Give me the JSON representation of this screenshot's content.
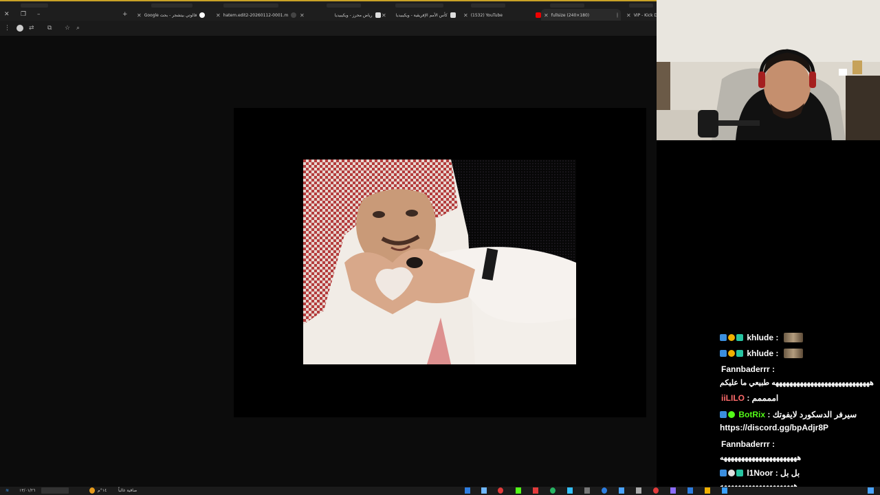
{
  "browser": {
    "tabs": [
      {
        "label": "Google ﻗﺎﻟﻮﺗﻲ ﺑﻴﺘﺸﺠﺮ - ﺑﺤﺚ",
        "favicon_color": "#ffffff"
      },
      {
        "label": "hatem.edit2-20260112-0001.m",
        "favicon_color": "#ff4d4d"
      },
      {
        "label": "ﺭﻳﺎﺽ ﻣﺤﺮﺯ - ﻭﻳﻜﻴﺒﻴﺪﻳﺎ",
        "favicon_color": "#dddddd"
      },
      {
        "label": "ﻛﺄﺱ ﺍﻷﻣﻢ ﺍﻹﻓﺮﻳﻘﻴﺔ - ﻭﻳﻜﻴﺒﻴﺪﻳﺎ",
        "favicon_color": "#dddddd"
      },
      {
        "label": "(1532) YouTube",
        "favicon_color": "#ff0000"
      },
      {
        "label": "fullsize (240×180)",
        "favicon_color": "#555555"
      },
      {
        "label": "VIP - Kick Do",
        "favicon_color": "#53fc18"
      }
    ]
  },
  "taskbar": {
    "date": "١٣/٠١/٢٦",
    "weather": "١٤°م",
    "status": "ﺻﺎﻓﻴﺔ ﻏﺎﻟﺒﺎً"
  },
  "chat": {
    "messages": [
      {
        "user": "khlude",
        "user_color": "#ffffff",
        "text": "",
        "emote": "smiling-face-emote"
      },
      {
        "user": "khlude",
        "user_color": "#ffffff",
        "text": "",
        "emote": "smiling-face-emote"
      },
      {
        "user": "Fannbaderrr",
        "user_color": "#ffffff",
        "text": "ﻫﻬﻬﻬﻬﻬﻬﻬﻬﻬﻬﻬﻬﻬﻬﻬﻬﻬﻬﻬﻬﻬﻬﻬﻬﻬﻬﻬﻪ ﻃﺒﻴﻌﻲ ﻣﺎ ﻋﻠﻴﻜﻢ"
      },
      {
        "user": "iiLILO",
        "user_color": "#ff6b6b",
        "text": "ﺍﻣﻤﻤﻤﻢ"
      },
      {
        "user": "BotRix",
        "user_color": "#53fc18",
        "text": "ﺳﻴﺮﻓﺮ ﺍﻟﺪﺳﻜﻮﺭﺩ ﻻﻳﻔﻮﺗﻚ",
        "text2": "https://discord.gg/bpAdjr8P"
      },
      {
        "user": "Fannbaderrr",
        "user_color": "#ffffff",
        "text": "ﻫﻬﻬﻬﻬﻬﻬﻬﻬﻬﻬﻬﻬﻬﻬﻬﻬﻬﻬﻬﻬﻬﻪ"
      },
      {
        "user": "l1Noor",
        "user_color": "#ffffff",
        "text": "ﺑﻞ ﺑﻞ",
        "text2": "ﻫﻬﻬﻬﻬﻬﻬﻬﻬﻬﻬﻬﻬﻬﻬﻬﻬﻬﻬﻬﻬﻪ"
      }
    ]
  },
  "colors": {
    "accent": "#c9a227",
    "kick_green": "#53fc18"
  }
}
